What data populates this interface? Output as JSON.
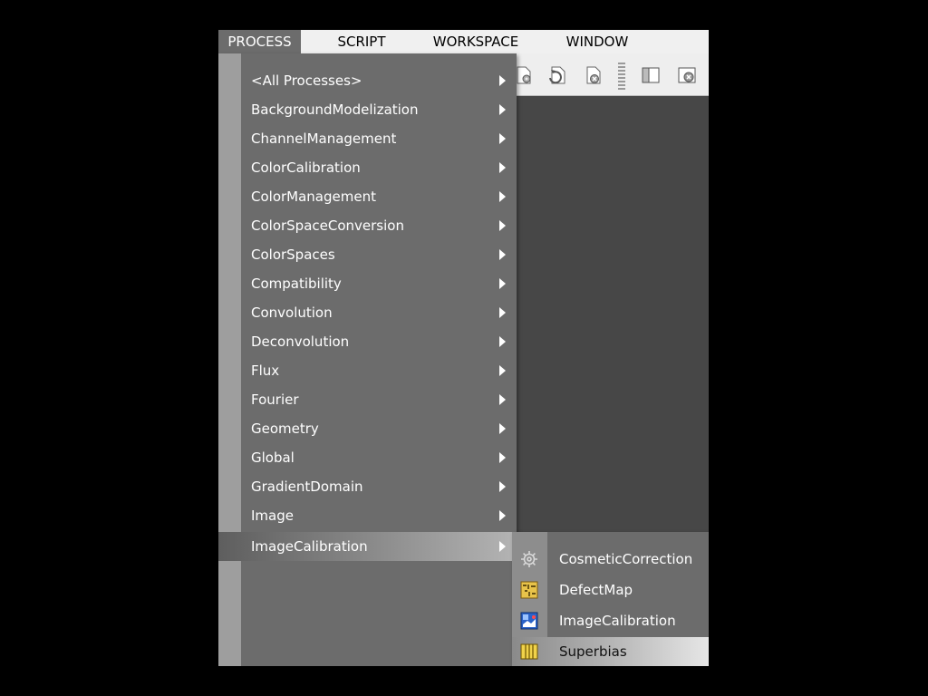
{
  "menubar": {
    "items": [
      "PROCESS",
      "SCRIPT",
      "WORKSPACE",
      "WINDOW"
    ]
  },
  "toolbar": {
    "icons": [
      "gear-doc-icon",
      "refresh-doc-icon",
      "close-doc-icon",
      "grip-separator",
      "panel-icon",
      "close-panel-icon"
    ]
  },
  "process_menu": {
    "items": [
      "<All Processes>",
      "BackgroundModelization",
      "ChannelManagement",
      "ColorCalibration",
      "ColorManagement",
      "ColorSpaceConversion",
      "ColorSpaces",
      "Compatibility",
      "Convolution",
      "Deconvolution",
      "Flux",
      "Fourier",
      "Geometry",
      "Global",
      "GradientDomain",
      "Image",
      "ImageCalibration"
    ],
    "highlighted": "ImageCalibration"
  },
  "submenu": {
    "items": [
      {
        "label": "CosmeticCorrection",
        "icon": "gear-icon"
      },
      {
        "label": "DefectMap",
        "icon": "defect-map-icon"
      },
      {
        "label": "ImageCalibration",
        "icon": "image-calibration-icon"
      },
      {
        "label": "Superbias",
        "icon": "superbias-icon"
      }
    ],
    "highlighted": "Superbias"
  },
  "colors": {
    "menu_bg": "#6c6c6c",
    "menubar_bg": "#f0f0f0",
    "workspace_bg": "#474747"
  }
}
